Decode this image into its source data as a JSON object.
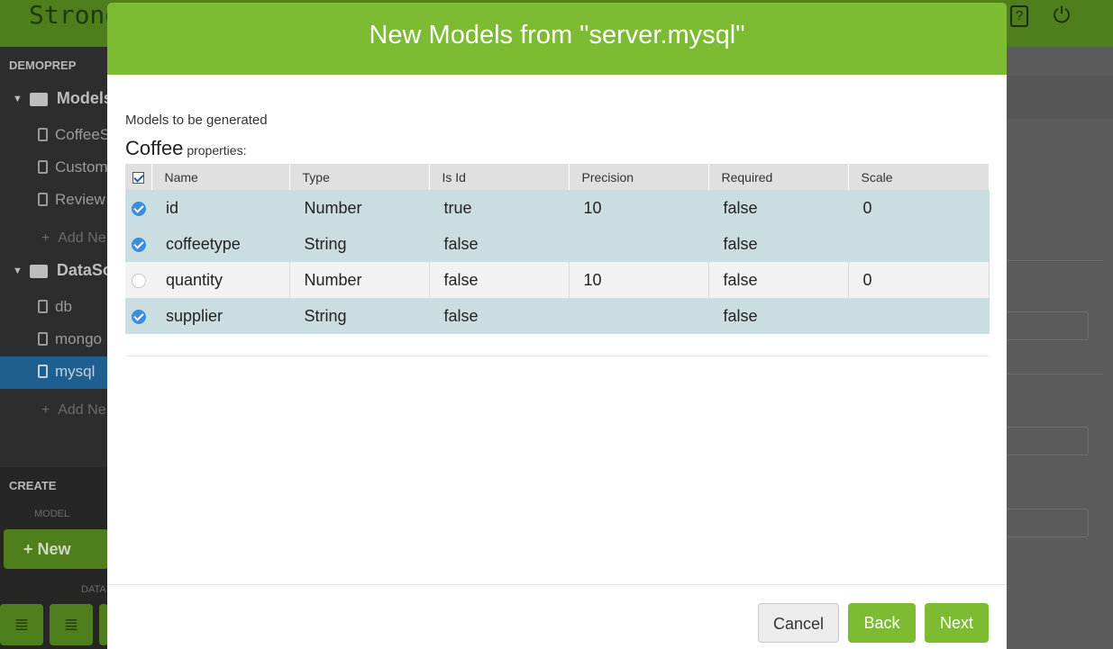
{
  "app": {
    "logo": "Strong",
    "help_icon": "help-icon",
    "power_icon": "power-icon"
  },
  "sidebar": {
    "project": "DEMOPREP",
    "groups": [
      {
        "label": "Models",
        "items": [
          "CoffeeS",
          "Custom",
          "Review"
        ],
        "add": "Add Ne"
      },
      {
        "label": "DataSo",
        "items": [
          "db",
          "mongo",
          "mysql"
        ],
        "add": "Add Ne"
      }
    ],
    "selected_item": "mysql",
    "create_label": "CREATE",
    "model_label": "MODEL",
    "new_button": "New",
    "data_label": "DATA"
  },
  "modal": {
    "title": "New Models from \"server.mysql\"",
    "subtitle": "Models to be generated",
    "model_name": "Coffee",
    "properties_suffix": "properties:",
    "columns": [
      "Name",
      "Type",
      "Is Id",
      "Precision",
      "Required",
      "Scale"
    ],
    "rows": [
      {
        "selected": true,
        "name": "id",
        "type": "Number",
        "is_id": "true",
        "precision": "10",
        "required": "false",
        "scale": "0"
      },
      {
        "selected": true,
        "name": "coffeetype",
        "type": "String",
        "is_id": "false",
        "precision": "",
        "required": "false",
        "scale": ""
      },
      {
        "selected": false,
        "name": "quantity",
        "type": "Number",
        "is_id": "false",
        "precision": "10",
        "required": "false",
        "scale": "0"
      },
      {
        "selected": true,
        "name": "supplier",
        "type": "String",
        "is_id": "false",
        "precision": "",
        "required": "false",
        "scale": ""
      }
    ],
    "buttons": {
      "cancel": "Cancel",
      "back": "Back",
      "next": "Next"
    }
  },
  "colors": {
    "accent_green": "#7cbb32",
    "row_selected": "#cadee2",
    "check_blue": "#3c8de0"
  }
}
